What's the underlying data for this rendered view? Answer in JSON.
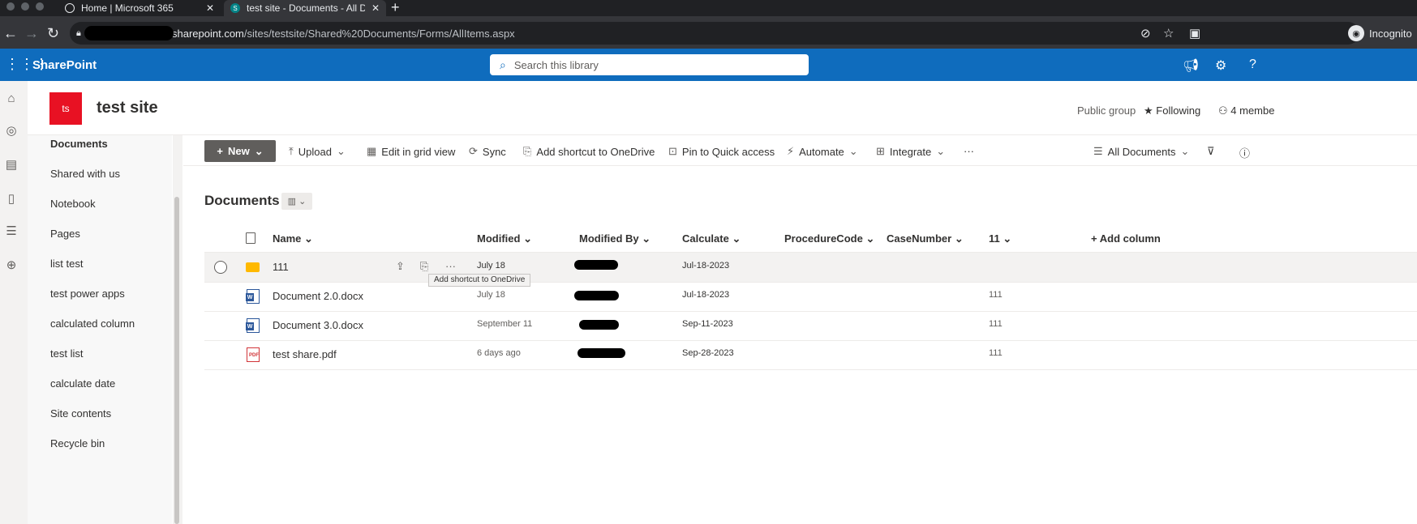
{
  "browser": {
    "tabs": [
      {
        "title": "Home | Microsoft 365"
      },
      {
        "title": "test site - Documents - All Do"
      }
    ],
    "url": {
      "host": "sharepoint.com",
      "path": "/sites/testsite/Shared%20Documents/Forms/AllItems.aspx"
    },
    "profile_label": "Incognito"
  },
  "suite": {
    "app_name": "SharePoint",
    "search_placeholder": "Search this library"
  },
  "site": {
    "logo_initials": "ts",
    "title": "test site",
    "group_type": "Public group",
    "follow_label": "Following",
    "members_label": "4 membe"
  },
  "leftnav": {
    "items": [
      {
        "label": "Documents"
      },
      {
        "label": "Shared with us"
      },
      {
        "label": "Notebook"
      },
      {
        "label": "Pages"
      },
      {
        "label": "list test"
      },
      {
        "label": "test power apps"
      },
      {
        "label": "calculated column"
      },
      {
        "label": "test list"
      },
      {
        "label": "calculate date"
      },
      {
        "label": "Site contents"
      },
      {
        "label": "Recycle bin"
      }
    ]
  },
  "commandbar": {
    "new_label": "New",
    "upload_label": "Upload",
    "grid_label": "Edit in grid view",
    "sync_label": "Sync",
    "shortcut_label": "Add shortcut to OneDrive",
    "pin_label": "Pin to Quick access",
    "automate_label": "Automate",
    "integrate_label": "Integrate",
    "more_label": "···",
    "view_label": "All Documents"
  },
  "library": {
    "title": "Documents",
    "columns": {
      "name": "Name",
      "modified": "Modified",
      "modified_by": "Modified By",
      "calculate": "Calculate",
      "procedure_code": "ProcedureCode",
      "case_number": "CaseNumber",
      "col11": "11",
      "add_column": "Add column"
    },
    "rows": [
      {
        "name": "111",
        "type": "folder",
        "modified": "July 18",
        "calculate": "Jul-18-2023",
        "col11": ""
      },
      {
        "name": "Document 2.0.docx",
        "type": "word",
        "modified": "July 18",
        "calculate": "Jul-18-2023",
        "col11": "111"
      },
      {
        "name": "Document 3.0.docx",
        "type": "word",
        "modified": "September 11",
        "calculate": "Sep-11-2023",
        "col11": "111"
      },
      {
        "name": "test share.pdf",
        "type": "pdf",
        "modified": "6 days ago",
        "calculate": "Sep-28-2023",
        "col11": "111"
      }
    ],
    "tooltip": "Add shortcut to OneDrive"
  },
  "colors": {
    "suite_bar": "#0f6cbd",
    "site_logo": "#e81123",
    "folder": "#ffb900",
    "word": "#2b579a",
    "pdf": "#d13438"
  }
}
